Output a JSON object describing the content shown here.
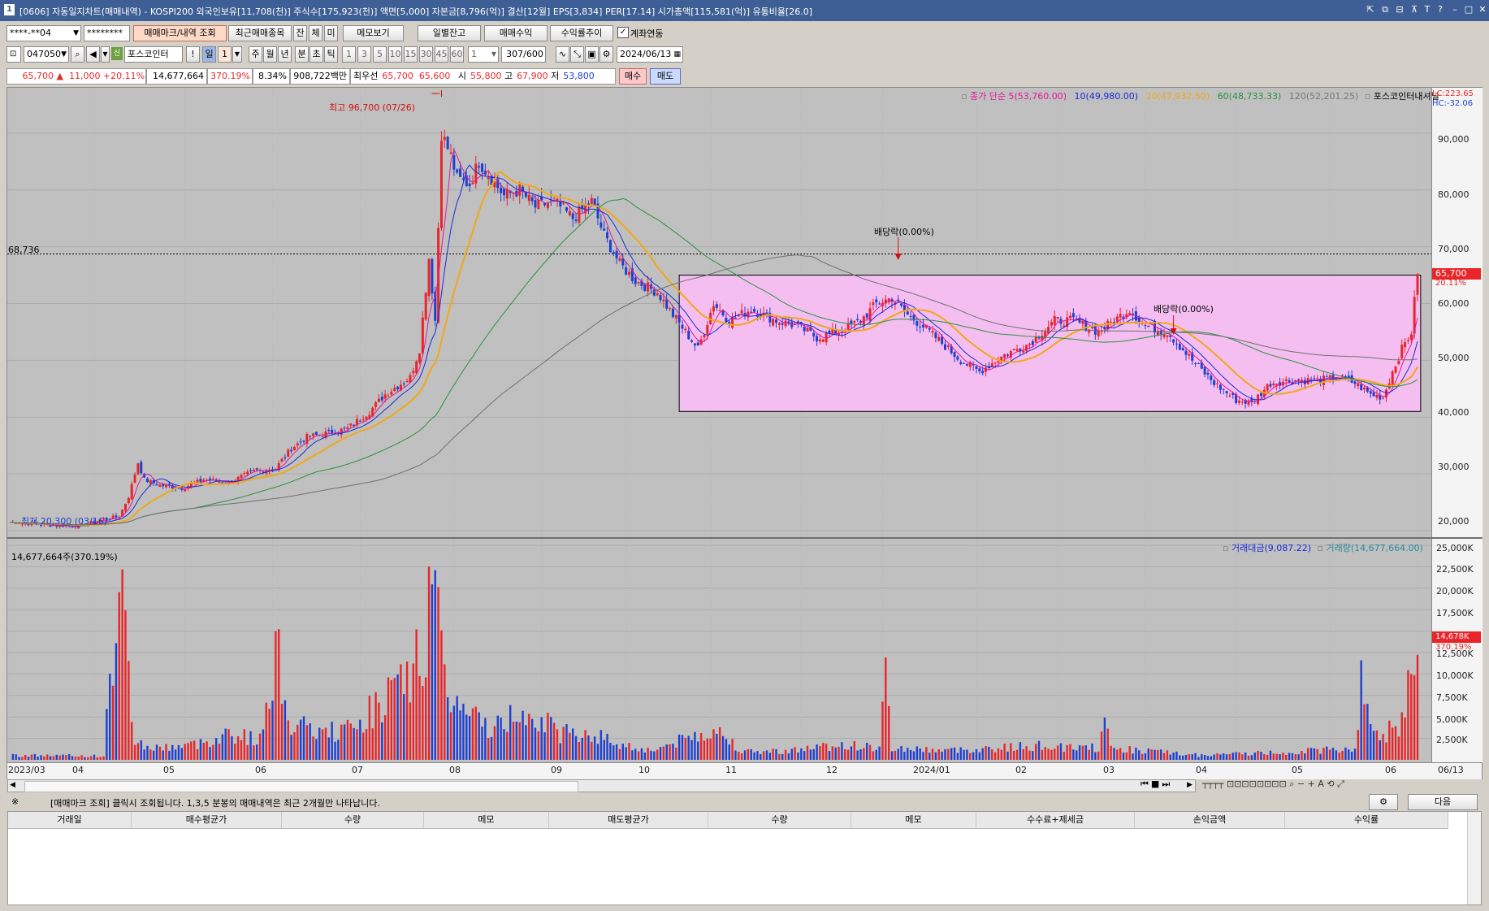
{
  "window": {
    "title": "[0606] 자동일지차트(매매내역) - KOSPI200 외국인보유[11,708(천)] 주식수[175,923(천)] 액면[5,000] 자본금[8,796(억)] 결산[12월] EPS[3,834] PER[17.14] 시가총액[115,581(억)] 유통비율[26.0]",
    "icon_label": "1"
  },
  "toolbar1": {
    "account": "****-**04",
    "password": "********",
    "tab_mark": "매매마크/내역 조회",
    "tab_recent": "최근매매종목",
    "tab_jan": "잔",
    "tab_che": "체",
    "tab_mi": "미",
    "memo_btn": "메모보기",
    "daily_btn": "일별잔고",
    "profit_btn": "매매수익",
    "trend_btn": "수익률추이",
    "link_label": "계좌연동",
    "link_checked": true
  },
  "toolbar2": {
    "code": "047050",
    "stock_name": "포스코인터",
    "period_day": "일",
    "period_num": "1",
    "periods": [
      "주",
      "월",
      "년",
      "분",
      "초",
      "틱"
    ],
    "minutes": [
      "1",
      "3",
      "5",
      "10",
      "15",
      "30",
      "45",
      "60"
    ],
    "count_sel": "1",
    "count": "307/600",
    "date": "2024/06/13"
  },
  "quote": {
    "price": "65,700",
    "arrow": "▲",
    "change": "11,000",
    "change_pct": "+20.11%",
    "volume": "14,677,664",
    "vol_pct": "370.19%",
    "turnover": "8.34%",
    "amount": "908,722백만",
    "best_label": "최우선",
    "ask": "65,700",
    "bid": "65,600",
    "open_label": "시",
    "open": "55,800",
    "high_label": "고",
    "high": "67,900",
    "low_label": "저",
    "low": "53,800",
    "buy_btn": "매수",
    "sell_btn": "매도"
  },
  "colors": {
    "up": "#e8262a",
    "down": "#1f3fd0",
    "ma5": "#e5189b",
    "ma10": "#1a2ad8",
    "ma20": "#f0a818",
    "ma60": "#2a9040",
    "ma120": "#707070",
    "box_fill": "#f4bff0"
  },
  "legend": {
    "price_label": "종가 단순",
    "ma5": "5(53,760.00)",
    "ma10": "10(49,980.00)",
    "ma20": "20(47,932.50)",
    "ma60": "60(48,733.33)",
    "ma120": "120(52,201.25)",
    "account_name": "포스코인터내셔널",
    "lc": "LC:223.65",
    "hc": "HC:-32.06"
  },
  "annotations": {
    "high_note": "최고 96,700 (07/26)",
    "low_note": "최저 20,300 (03/16)",
    "ref_line": "68,736",
    "dividend_1": "배당락(0.00%)",
    "dividend_2": "배당락(0.00%)",
    "last_price": "65,700",
    "last_pct": "20.11%"
  },
  "price_ticks": [
    "90,000",
    "80,000",
    "70,000",
    "60,000",
    "50,000",
    "40,000",
    "30,000",
    "20,000"
  ],
  "volume_ticks": [
    "25,000K",
    "22,500K",
    "20,000K",
    "17,500K",
    "12,500K",
    "10,000K",
    "7,500K",
    "5,000K",
    "2,500K"
  ],
  "volume_panel": {
    "label": "14,677,664주(370.19%)",
    "legend_amount": "거래대금(9,087.22)",
    "legend_volume": "거래량(14,677,664.00)",
    "last_vol": "14,678K",
    "last_pct": "370.19%"
  },
  "x_labels": [
    "2023/03",
    "04",
    "05",
    "06",
    "07",
    "08",
    "09",
    "10",
    "11",
    "12",
    "2024/01",
    "02",
    "03",
    "04",
    "05",
    "06",
    "06/13"
  ],
  "bottom": {
    "notice_mark": "※",
    "notice": "[매매마크 조회] 클릭시 조회됩니다. 1,3,5 분봉의 매매내역은 최근 2개월만 나타납니다.",
    "next_btn": "다음",
    "columns": [
      "거래일",
      "매수평균가",
      "수량",
      "메모",
      "매도평균가",
      "수량",
      "메모",
      "수수료+제세금",
      "손익금액",
      "수익률"
    ]
  },
  "chart_data": {
    "type": "candlestick",
    "ylim": [
      19000,
      98000
    ],
    "volume_ylim": [
      0,
      25000
    ],
    "moving_averages": [
      "5",
      "10",
      "20",
      "60",
      "120"
    ],
    "highlight_box": {
      "y_range": [
        41000,
        65000
      ]
    },
    "close_path": [
      [
        0,
        21500
      ],
      [
        12,
        21000
      ],
      [
        22,
        20800
      ],
      [
        30,
        22000
      ],
      [
        35,
        22500
      ],
      [
        38,
        26000
      ],
      [
        41,
        32000
      ],
      [
        43,
        29000
      ],
      [
        48,
        28000
      ],
      [
        55,
        27500
      ],
      [
        62,
        29000
      ],
      [
        70,
        28500
      ],
      [
        78,
        30500
      ],
      [
        85,
        31000
      ],
      [
        90,
        34500
      ],
      [
        95,
        36500
      ],
      [
        100,
        37000
      ],
      [
        108,
        38000
      ],
      [
        115,
        41000
      ],
      [
        120,
        44000
      ],
      [
        128,
        47000
      ],
      [
        131,
        52000
      ],
      [
        134,
        68000
      ],
      [
        136,
        57000
      ],
      [
        138,
        90000
      ],
      [
        141,
        86000
      ],
      [
        143,
        82000
      ],
      [
        147,
        81000
      ],
      [
        150,
        85000
      ],
      [
        154,
        82000
      ],
      [
        158,
        79000
      ],
      [
        163,
        80000
      ],
      [
        168,
        77000
      ],
      [
        174,
        78000
      ],
      [
        180,
        75000
      ],
      [
        186,
        78000
      ],
      [
        190,
        72000
      ],
      [
        195,
        67000
      ],
      [
        200,
        64000
      ],
      [
        207,
        62000
      ],
      [
        212,
        58000
      ],
      [
        216,
        55000
      ],
      [
        220,
        52000
      ],
      [
        225,
        60000
      ],
      [
        230,
        57000
      ],
      [
        237,
        59000
      ],
      [
        245,
        57000
      ],
      [
        252,
        56000
      ],
      [
        258,
        54000
      ],
      [
        265,
        55000
      ],
      [
        272,
        57000
      ],
      [
        277,
        60000
      ],
      [
        282,
        61000
      ],
      [
        287,
        58000
      ],
      [
        292,
        56000
      ],
      [
        298,
        53000
      ],
      [
        304,
        50000
      ],
      [
        310,
        48000
      ],
      [
        318,
        51000
      ],
      [
        326,
        53000
      ],
      [
        334,
        57000
      ],
      [
        340,
        57000
      ],
      [
        348,
        55000
      ],
      [
        353,
        57000
      ],
      [
        358,
        59000
      ],
      [
        363,
        56000
      ],
      [
        370,
        55000
      ],
      [
        378,
        50000
      ],
      [
        385,
        46000
      ],
      [
        392,
        43000
      ],
      [
        397,
        42500
      ],
      [
        403,
        46000
      ],
      [
        410,
        46500
      ],
      [
        418,
        46500
      ],
      [
        425,
        47000
      ],
      [
        430,
        46000
      ],
      [
        435,
        44000
      ],
      [
        439,
        43500
      ],
      [
        442,
        48000
      ],
      [
        445,
        52000
      ],
      [
        448,
        55000
      ],
      [
        450,
        65700
      ]
    ],
    "volume_path": [
      [
        0,
        600
      ],
      [
        30,
        500
      ],
      [
        34,
        18500
      ],
      [
        36,
        20000
      ],
      [
        40,
        2500
      ],
      [
        45,
        1500
      ],
      [
        60,
        2000
      ],
      [
        70,
        3500
      ],
      [
        80,
        2500
      ],
      [
        85,
        14500
      ],
      [
        90,
        4500
      ],
      [
        100,
        3500
      ],
      [
        110,
        4000
      ],
      [
        118,
        7500
      ],
      [
        122,
        8500
      ],
      [
        128,
        10000
      ],
      [
        131,
        15000
      ],
      [
        133,
        12500
      ],
      [
        134,
        24500
      ],
      [
        136,
        18000
      ],
      [
        138,
        14500
      ],
      [
        142,
        7000
      ],
      [
        148,
        5500
      ],
      [
        155,
        4000
      ],
      [
        165,
        7000
      ],
      [
        175,
        3500
      ],
      [
        185,
        3500
      ],
      [
        195,
        2000
      ],
      [
        205,
        1200
      ],
      [
        215,
        2500
      ],
      [
        225,
        4000
      ],
      [
        235,
        1000
      ],
      [
        250,
        1200
      ],
      [
        265,
        2000
      ],
      [
        278,
        1500
      ],
      [
        280,
        10500
      ],
      [
        282,
        1500
      ],
      [
        300,
        1200
      ],
      [
        330,
        1800
      ],
      [
        348,
        1500
      ],
      [
        350,
        4500
      ],
      [
        352,
        1500
      ],
      [
        380,
        600
      ],
      [
        410,
        1000
      ],
      [
        430,
        1500
      ],
      [
        432,
        9500
      ],
      [
        434,
        5500
      ],
      [
        438,
        3500
      ],
      [
        440,
        2500
      ],
      [
        442,
        5500
      ],
      [
        444,
        4000
      ],
      [
        450,
        14678
      ]
    ]
  }
}
